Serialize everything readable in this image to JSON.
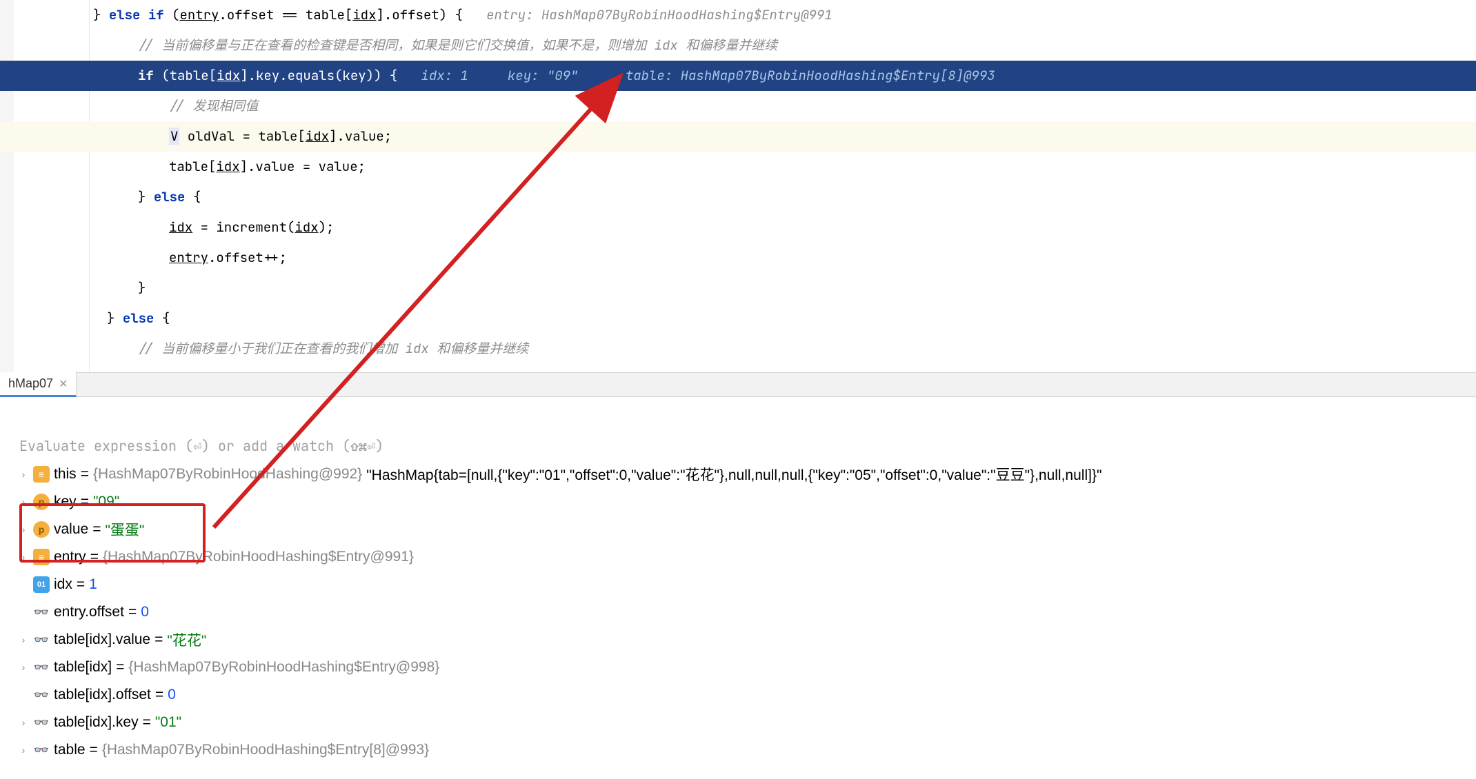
{
  "code": {
    "line1_pre": "} ",
    "line1_kw1": "else if",
    "line1_mid": " (",
    "line1_entry": "entry",
    "line1_off1": ".offset == table[",
    "line1_idx1": "idx",
    "line1_off2": "].offset) {",
    "line1_hint": "   entry: HashMap07ByRobinHoodHashing$Entry@991",
    "line2_comment": "// 当前偏移量与正在查看的检查键是否相同，如果是则它们交换值，如果不是，则增加 idx 和偏移量并继续",
    "line3_kw": "if",
    "line3_pre": " (table[",
    "line3_idx": "idx",
    "line3_mid": "].key.equals(key)) {",
    "line3_hint": "   idx: 1     key: \"09\"      table: HashMap07ByRobinHoodHashing$Entry[8]@993",
    "line4_comment": "// 发现相同值",
    "line5_v": "V",
    "line5_text": " oldVal = table[",
    "line5_idx": "idx",
    "line5_end": "].value;",
    "line6_text": "table[",
    "line6_idx": "idx",
    "line6_end": "].value = value;",
    "line7_close": "} ",
    "line7_kw": "else",
    "line7_open": " {",
    "line8_idx": "idx",
    "line8_text": " = increment(",
    "line8_idx2": "idx",
    "line8_end": ");",
    "line9_entry": "entry",
    "line9_text": ".offset++;",
    "line10": "}",
    "line11_close": "} ",
    "line11_kw": "else",
    "line11_open": " {",
    "line12_comment": "// 当前偏移量小于我们正在查看的我们增加 idx 和偏移量并继续"
  },
  "tab": {
    "label": "hMap07",
    "close": "✕"
  },
  "debug": {
    "eval_prompt": "Evaluate expression (⏎) or add a watch (⇧⌘⏎)",
    "vars": {
      "this_name": "this",
      "this_eq": " = ",
      "this_type": "{HashMap07ByRobinHoodHashing@992} ",
      "this_val": "\"HashMap{tab=[null,{\"key\":\"01\",\"offset\":0,\"value\":\"花花\"},null,null,null,{\"key\":\"05\",\"offset\":0,\"value\":\"豆豆\"},null,null]}\"",
      "key_name": "key",
      "key_eq": " = ",
      "key_val": "\"09\"",
      "value_name": "value",
      "value_eq": " = ",
      "value_val": "\"蛋蛋\"",
      "entry_name": "entry",
      "entry_eq": " = ",
      "entry_val": "{HashMap07ByRobinHoodHashing$Entry@991}",
      "idx_name": "idx",
      "idx_eq": " = ",
      "idx_val": "1",
      "entryoff_name": "entry.offset",
      "entryoff_eq": " = ",
      "entryoff_val": "0",
      "tiv_name": "table[idx].value",
      "tiv_eq": " = ",
      "tiv_val": "\"花花\"",
      "ti_name": "table[idx]",
      "ti_eq": " = ",
      "ti_val": "{HashMap07ByRobinHoodHashing$Entry@998}",
      "tio_name": "table[idx].offset",
      "tio_eq": " = ",
      "tio_val": "0",
      "tik_name": "table[idx].key",
      "tik_eq": " = ",
      "tik_val": "\"01\"",
      "table_name": "table",
      "table_eq": " = ",
      "table_val": "{HashMap07ByRobinHoodHashing$Entry[8]@993}"
    }
  }
}
